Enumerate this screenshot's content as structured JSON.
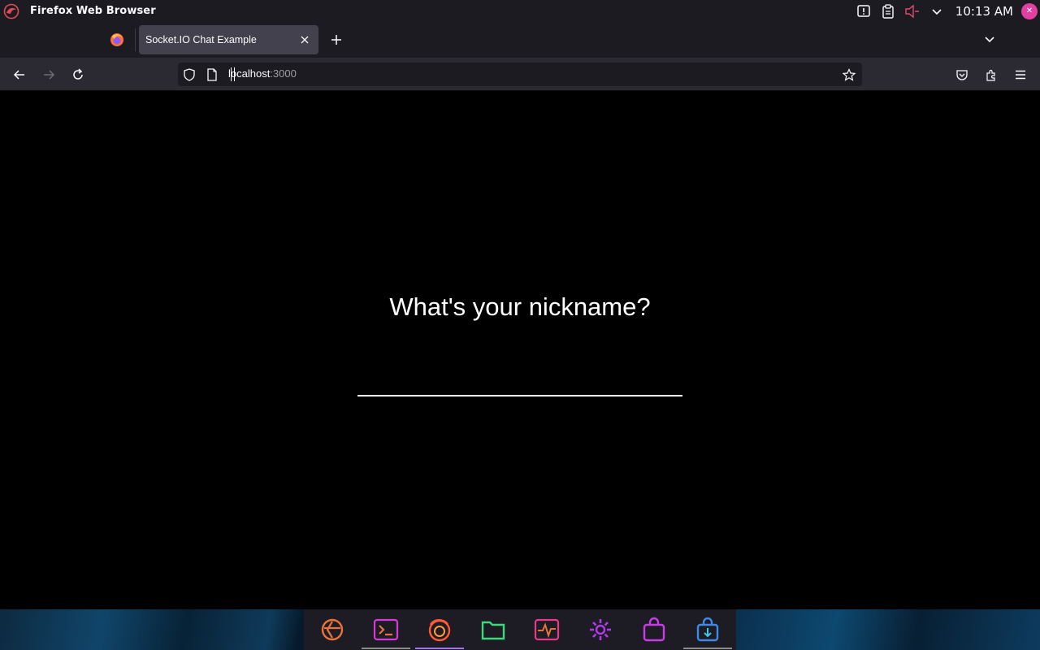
{
  "system_bar": {
    "app_title": "Firefox Web Browser",
    "clock": "10:13 AM",
    "icons": [
      "kali-dragon-icon",
      "notification-icon",
      "clipboard-icon",
      "volume-muted-icon",
      "chevron-down-icon",
      "user-avatar-icon"
    ]
  },
  "tabs": [
    {
      "label": "Socket.IO Chat Example",
      "active": true
    }
  ],
  "navbar": {
    "url_host": "localhost",
    "url_port": ":3000"
  },
  "page": {
    "prompt": "What's your nickname?",
    "nickname_value": ""
  },
  "dock": {
    "items": [
      "kali-menu-icon",
      "terminal-icon",
      "firefox-icon",
      "files-icon",
      "system-monitor-icon",
      "settings-icon",
      "software-store-icon",
      "app-installer-icon"
    ],
    "active": "firefox-icon"
  },
  "colors": {
    "chrome_dark": "#1c1b22",
    "toolbar": "#2b2a33",
    "tab_active": "#42414d",
    "accent": "#a371f7",
    "user_dot": "#e23fa0"
  }
}
